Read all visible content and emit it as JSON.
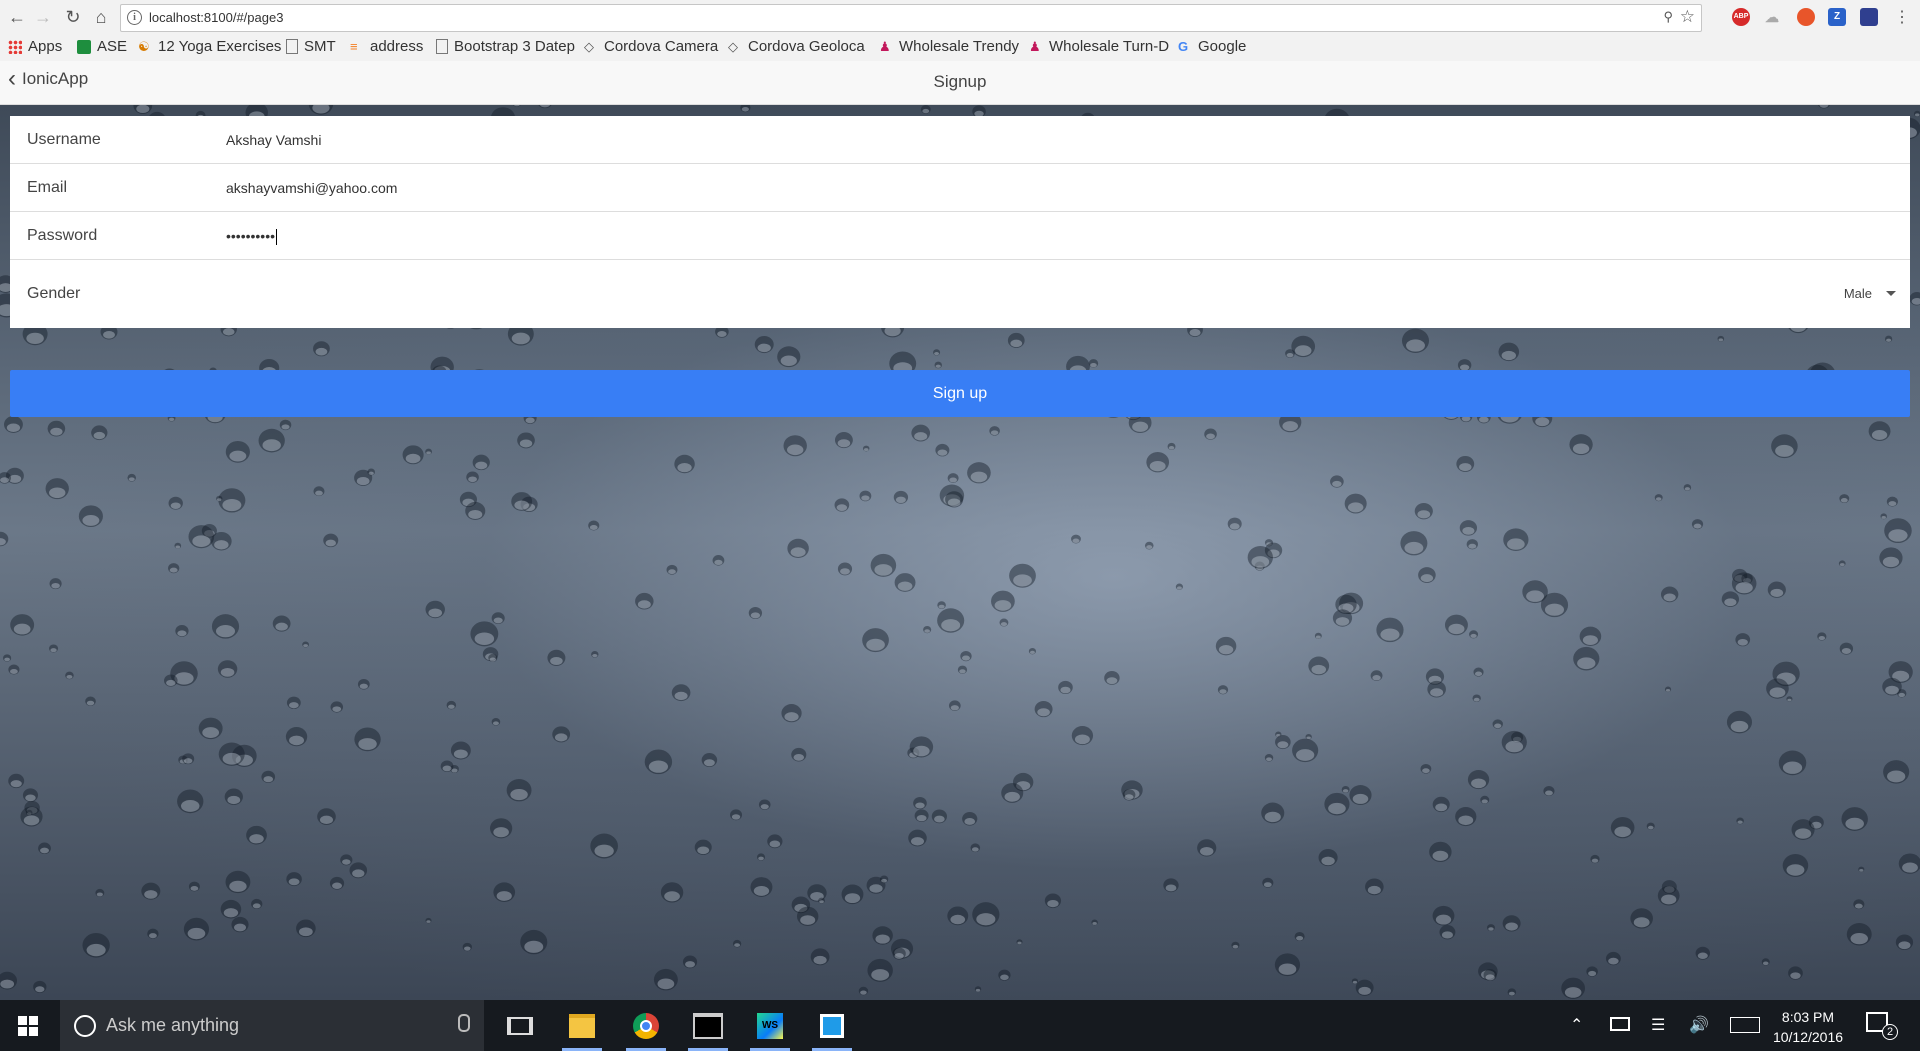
{
  "browser": {
    "url": "localhost:8100/#/page3",
    "bookmarks": [
      {
        "label": "Apps"
      },
      {
        "label": "ASE"
      },
      {
        "label": "12 Yoga Exercises"
      },
      {
        "label": "SMT"
      },
      {
        "label": "address"
      },
      {
        "label": "Bootstrap 3 Datep"
      },
      {
        "label": "Cordova Camera"
      },
      {
        "label": "Cordova Geoloca"
      },
      {
        "label": "Wholesale Trendy"
      },
      {
        "label": "Wholesale Turn-D"
      },
      {
        "label": "Google"
      }
    ],
    "extensions": [
      "ABP",
      "Z"
    ]
  },
  "app": {
    "back_label": "IonicApp",
    "title": "Signup",
    "fields": {
      "username": {
        "label": "Username",
        "value": "Akshay Vamshi"
      },
      "email": {
        "label": "Email",
        "value": "akshayvamshi@yahoo.com"
      },
      "password": {
        "label": "Password",
        "value": "••••••••••"
      },
      "gender": {
        "label": "Gender",
        "value": "Male"
      }
    },
    "signup_button": "Sign up"
  },
  "taskbar": {
    "search_placeholder": "Ask me anything",
    "time": "8:03 PM",
    "date": "10/12/2016",
    "notifications_count": "2",
    "ws_icon_label": "WS"
  },
  "colors": {
    "primary": "#387ef5",
    "taskbar": "#161a1f"
  }
}
